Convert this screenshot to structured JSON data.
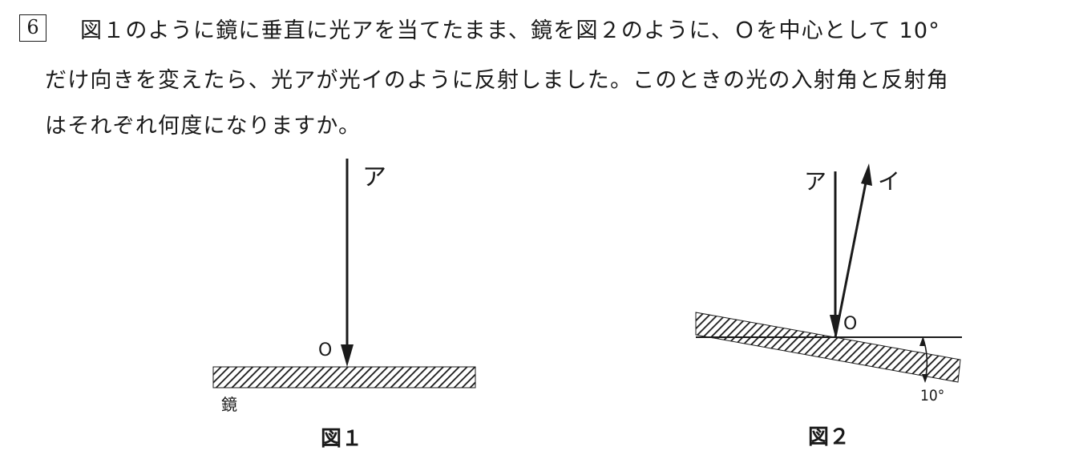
{
  "question": {
    "number": "6",
    "line1": "図１のように鏡に垂直に光アを当てたまま、鏡を図２のように、Ｏを中心として 10°",
    "line2": "だけ向きを変えたら、光アが光イのように反射しました。このときの光の入射角と反射角",
    "line3": "はそれぞれ何度になりますか。"
  },
  "figure1": {
    "ray_label": "ア",
    "point_label": "O",
    "mirror_label": "鏡",
    "caption": "図１"
  },
  "figure2": {
    "incident_label": "ア",
    "reflected_label": "イ",
    "point_label": "O",
    "angle_label": "10°",
    "caption": "図２"
  },
  "colors": {
    "ink": "#1a1a1a",
    "background": "#ffffff"
  }
}
